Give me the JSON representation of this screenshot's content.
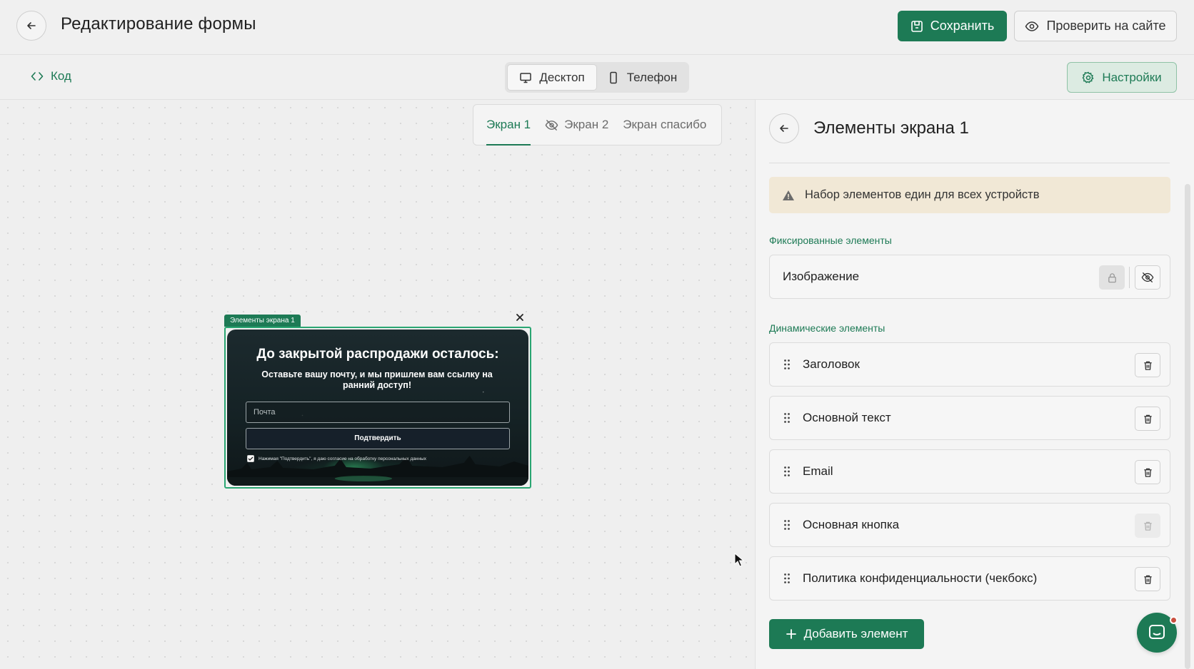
{
  "header": {
    "title": "Редактирование формы",
    "save_label": "Сохранить",
    "check_label": "Проверить на сайте"
  },
  "toolbar": {
    "code_label": "Код",
    "devices": [
      {
        "label": "Десктоп",
        "active": true
      },
      {
        "label": "Телефон",
        "active": false
      }
    ],
    "settings_label": "Настройки"
  },
  "canvas": {
    "screen_tabs": [
      {
        "label": "Экран 1",
        "active": true,
        "hidden": false
      },
      {
        "label": "Экран 2",
        "active": false,
        "hidden": true
      },
      {
        "label": "Экран спасибо",
        "active": false,
        "hidden": false
      }
    ],
    "preview": {
      "label": "Элементы экрана 1",
      "title": "До закрытой распродажи осталось:",
      "subtitle": "Оставьте вашу почту, и мы пришлем вам ссылку на ранний доступ!",
      "email_placeholder": "Почта",
      "button_label": "Подтвердить",
      "consent_text": "Нажимая \"Подтвердить\", я даю согласие на обработку персональных данных"
    }
  },
  "panel": {
    "title": "Элементы экрана 1",
    "warning": "Набор элементов един для всех устройств",
    "fixed_label": "Фиксированные элементы",
    "fixed_items": [
      {
        "label": "Изображение"
      }
    ],
    "dynamic_label": "Динамические элементы",
    "dynamic_items": [
      {
        "label": "Заголовок",
        "deletable": true
      },
      {
        "label": "Основной текст",
        "deletable": true
      },
      {
        "label": "Email",
        "deletable": true
      },
      {
        "label": "Основная кнопка",
        "deletable": false
      },
      {
        "label": "Политика конфиденциальности (чекбокс)",
        "deletable": true
      }
    ],
    "add_label": "Добавить элемент"
  },
  "colors": {
    "accent": "#1d7a55",
    "warning_bg": "#f1e8d6",
    "background": "#f0f0f0"
  },
  "icons": [
    "arrow-left-icon",
    "save-icon",
    "eye-icon",
    "code-icon",
    "monitor-icon",
    "phone-icon",
    "gear-icon",
    "eye-off-icon",
    "close-icon",
    "warning-icon",
    "lock-icon",
    "drag-handle-icon",
    "trash-icon",
    "plus-icon",
    "chat-icon"
  ]
}
